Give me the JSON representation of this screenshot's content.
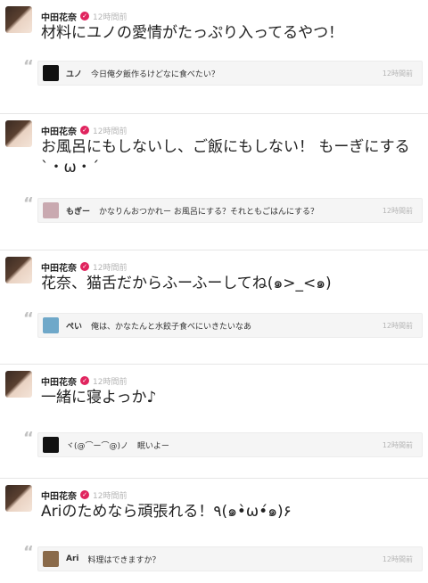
{
  "posts": [
    {
      "author": "中田花奈",
      "time": "12時間前",
      "message": "材料にユノの愛情がたっぷり入ってるやつ！",
      "reply": {
        "name": "ユノ",
        "text": "今日俺夕飯作るけどなに食べたい？",
        "time": "12時間前",
        "avatar_color": "#111111"
      }
    },
    {
      "author": "中田花奈",
      "time": "12時間前",
      "message": "お風呂にもしないし、ご飯にもしない！ もーぎにする`・ω・´",
      "reply": {
        "name": "もぎー",
        "text": "かなりんおつかれー お風呂にする？それともごはんにする？",
        "time": "12時間前",
        "avatar_color": "#c9a9b0"
      }
    },
    {
      "author": "中田花奈",
      "time": "12時間前",
      "message": "花奈、猫舌だからふーふーしてね(๑>_<๑)",
      "reply": {
        "name": "ぺい",
        "text": "俺は、かなたんと水餃子食べにいきたいなあ",
        "time": "12時間前",
        "avatar_color": "#6fa8c9"
      }
    },
    {
      "author": "中田花奈",
      "time": "12時間前",
      "message": "一緒に寝よっか♪",
      "reply": {
        "name": "ヾ(@⌒ー⌒@)ノ",
        "text": "眠いよー",
        "time": "12時間前",
        "avatar_color": "#111111"
      }
    },
    {
      "author": "中田花奈",
      "time": "12時間前",
      "message": "Ariのためなら頑張れる！٩(๑•̀ω•́๑)۶",
      "reply": {
        "name": "Ari",
        "text": "料理はできますか？",
        "time": "12時間前",
        "avatar_color": "#8a6a4a"
      }
    }
  ]
}
